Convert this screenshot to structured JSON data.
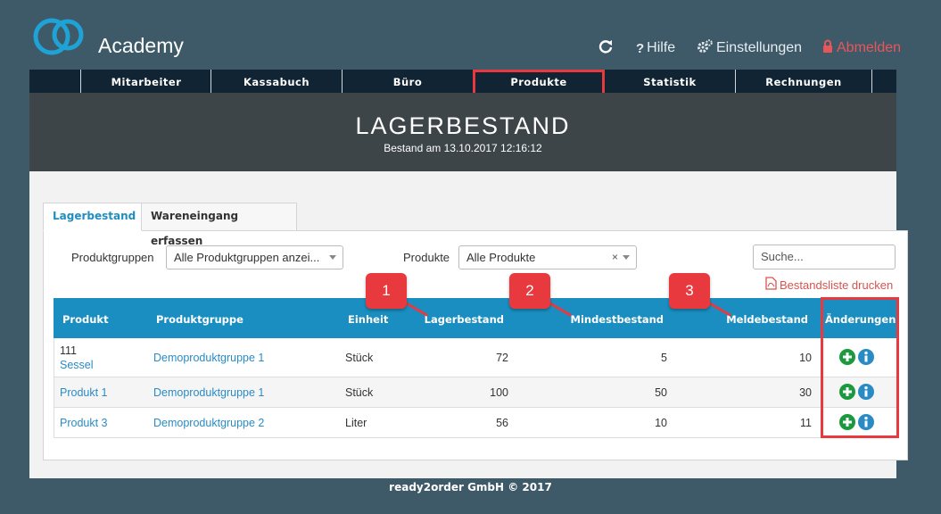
{
  "app": {
    "brand": "Academy"
  },
  "topnav": {
    "help": "Hilfe",
    "settings": "Einstellungen",
    "logout": "Abmelden"
  },
  "menu": {
    "items": [
      "Mitarbeiter",
      "Kassabuch",
      "Büro",
      "Produkte",
      "Statistik",
      "Rechnungen"
    ],
    "active": "Produkte"
  },
  "page": {
    "title": "LAGERBESTAND",
    "subtitle": "Bestand am 13.10.2017 12:16:12"
  },
  "tabs": {
    "active": "Lagerbestand",
    "inactive": "Wareneingang erfassen"
  },
  "filters": {
    "productgroups_label": "Produktgruppen",
    "productgroups_value": "Alle Produktgruppen anzei...",
    "products_label": "Produkte",
    "products_value": "Alle Produkte",
    "clear": "×",
    "search_placeholder": "Suche...",
    "print_link": "Bestandsliste drucken"
  },
  "table": {
    "headers": [
      "Produkt",
      "Produktgruppe",
      "Einheit",
      "Lagerbestand",
      "Mindestbestand",
      "Meldebestand",
      "Änderungen"
    ],
    "rows": [
      {
        "number": "111",
        "product": "Sessel",
        "group": "Demoproduktgruppe 1",
        "unit": "Stück",
        "stock": "72",
        "min": "5",
        "report": "10"
      },
      {
        "number": "",
        "product": "Produkt 1",
        "group": "Demoproduktgruppe 1",
        "unit": "Stück",
        "stock": "100",
        "min": "50",
        "report": "30"
      },
      {
        "number": "",
        "product": "Produkt 3",
        "group": "Demoproduktgruppe 2",
        "unit": "Liter",
        "stock": "56",
        "min": "10",
        "report": "11"
      }
    ]
  },
  "markers": [
    "1",
    "2",
    "3"
  ],
  "footer": "ready2order GmbH © 2017",
  "colors": {
    "accent": "#1a8ec1",
    "highlight": "#e8393f",
    "navbar": "#102433",
    "background": "#3e5a69",
    "add": "#1a9a3c"
  },
  "icons": [
    "logo-icon",
    "refresh-icon",
    "question-icon",
    "gears-icon",
    "lock-icon",
    "pdf-icon",
    "plus-circle-icon",
    "info-circle-icon"
  ]
}
